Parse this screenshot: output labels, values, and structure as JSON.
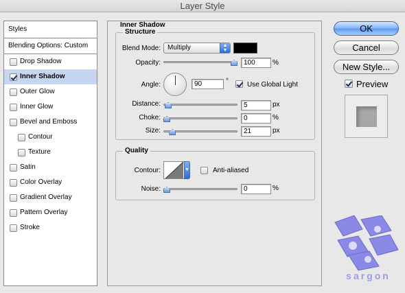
{
  "window": {
    "title": "Layer Style"
  },
  "left_panel": {
    "header": "Styles",
    "blending_options": "Blending Options: Custom",
    "items": [
      {
        "label": "Drop Shadow",
        "checked": false,
        "selected": false,
        "sub": false
      },
      {
        "label": "Inner Shadow",
        "checked": true,
        "selected": true,
        "sub": false
      },
      {
        "label": "Outer Glow",
        "checked": false,
        "selected": false,
        "sub": false
      },
      {
        "label": "Inner Glow",
        "checked": false,
        "selected": false,
        "sub": false
      },
      {
        "label": "Bevel and Emboss",
        "checked": false,
        "selected": false,
        "sub": false
      },
      {
        "label": "Contour",
        "checked": false,
        "selected": false,
        "sub": true
      },
      {
        "label": "Texture",
        "checked": false,
        "selected": false,
        "sub": true
      },
      {
        "label": "Satin",
        "checked": false,
        "selected": false,
        "sub": false
      },
      {
        "label": "Color Overlay",
        "checked": false,
        "selected": false,
        "sub": false
      },
      {
        "label": "Gradient Overlay",
        "checked": false,
        "selected": false,
        "sub": false
      },
      {
        "label": "Pattern Overlay",
        "checked": false,
        "selected": false,
        "sub": false
      },
      {
        "label": "Stroke",
        "checked": false,
        "selected": false,
        "sub": false
      }
    ]
  },
  "main": {
    "title": "Inner Shadow",
    "structure": {
      "title": "Structure",
      "blend_mode_label": "Blend Mode:",
      "blend_mode_value": "Multiply",
      "shadow_color": "#000000",
      "opacity_label": "Opacity:",
      "opacity_value": "100",
      "opacity_unit": "%",
      "opacity_level": 1.0,
      "angle_label": "Angle:",
      "angle_value": "90",
      "angle_unit": "°",
      "use_global_light_label": "Use Global Light",
      "use_global_light": true,
      "distance_label": "Distance:",
      "distance_value": "5",
      "distance_unit": "px",
      "distance_level": 0.02,
      "choke_label": "Choke:",
      "choke_value": "0",
      "choke_unit": "%",
      "choke_level": 0.0,
      "size_label": "Size:",
      "size_value": "21",
      "size_unit": "px",
      "size_level": 0.085
    },
    "quality": {
      "title": "Quality",
      "contour_label": "Contour:",
      "anti_aliased_label": "Anti-aliased",
      "anti_aliased": false,
      "noise_label": "Noise:",
      "noise_value": "0",
      "noise_unit": "%",
      "noise_level": 0.0
    }
  },
  "buttons": {
    "ok": "OK",
    "cancel": "Cancel",
    "new_style": "New Style...",
    "preview_label": "Preview",
    "preview_checked": true
  },
  "logo": {
    "text": "sargon",
    "color": "#8a8ae6"
  },
  "colors": {
    "selection": "#c7d6f0",
    "accent": "#5b97ee"
  }
}
